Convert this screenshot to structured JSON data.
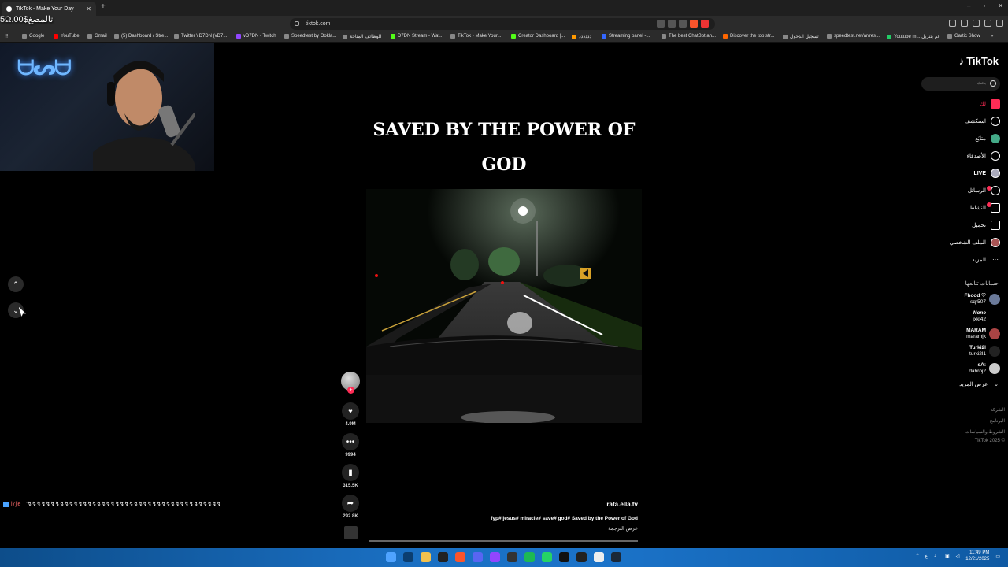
{
  "browser": {
    "tab_title": "TikTok - Make Your Day",
    "new_tab": "+",
    "window_controls": [
      "–",
      "▫",
      "✕"
    ],
    "url": "tiktok.com"
  },
  "bookmarks": [
    "Google",
    "YouTube",
    "Gmail",
    "(5) Dashboard / Stre...",
    "Twitter \\ D7DN (vD7...",
    "vD7DN - Twitch",
    "Speedtest by Ookla...",
    "الوظائف المتاحة",
    "D7DN Stream - Wat...",
    "TikTok - Make Your...",
    "Creator Dashboard |...",
    "دددددد",
    "Streaming panel -...",
    "The best ChatBot an...",
    "Discover the top str...",
    "تسجيل الدخول",
    "speedtest.net/ar/res...",
    "Youtube m... قم بتنزيل",
    "Gartic Show"
  ],
  "overlay": {
    "money": "5Ω.00$تالمصغ",
    "chat_user": "l7jje",
    "chat_message": ": '↯↯↯↯↯↯↯↯↯↯↯↯↯↯↯↯↯↯↯↯↯↯↯↯↯↯↯↯↯↯↯↯↯↯↯↯↯↯↯↯↯↯"
  },
  "video": {
    "title_line1": "SAVED BY THE POWER OF",
    "title_line2": "GOD",
    "username": "rafa.ella.tv",
    "description": "fyp# jesus# miracle# save# god# Saved by the Power of God",
    "translate": "عرض الترجمة",
    "likes": "4.9M",
    "comments": "9994",
    "saves": "315.5K",
    "shares": "292.8K"
  },
  "tiktok": {
    "logo": "TikTok",
    "search_placeholder": "بحث",
    "nav": [
      {
        "label": "لك",
        "icon": "home-icon"
      },
      {
        "label": "استكشف",
        "icon": "compass-icon"
      },
      {
        "label": "متابَع",
        "icon": "following-icon"
      },
      {
        "label": "الأصدقاء",
        "icon": "friends-icon"
      },
      {
        "label": "LIVE",
        "icon": "live-icon"
      },
      {
        "label": "الرسائل",
        "icon": "messages-icon"
      },
      {
        "label": "النشاط",
        "icon": "activity-icon"
      },
      {
        "label": "تحميل",
        "icon": "upload-icon"
      },
      {
        "label": "الملف الشخصي",
        "icon": "profile-icon"
      },
      {
        "label": "المزيد",
        "icon": "more-icon"
      }
    ],
    "following_header": "حسابات تتابعها",
    "following": [
      {
        "name": "Fhood ♡",
        "handle": "sqr507"
      },
      {
        "name": "None",
        "handle": "jxkl42"
      },
      {
        "name": "MARAM",
        "handle": "_maramjk"
      },
      {
        "name": "Turki2l",
        "handle": "turki2l1"
      },
      {
        "name": "sA:",
        "handle": "dahroj2"
      }
    ],
    "see_more": "عرض المزيد",
    "footer": [
      "الشركة",
      "البرنامج",
      "الشروط والسياسات",
      "© 2025 TikTok"
    ]
  },
  "taskbar": {
    "time": "11:49 PM",
    "date": "12/21/2025",
    "lang": "ع"
  },
  "colors": {
    "tiktok_red": "#fe2c55",
    "taskbar_blue": "#1a6fc2"
  }
}
